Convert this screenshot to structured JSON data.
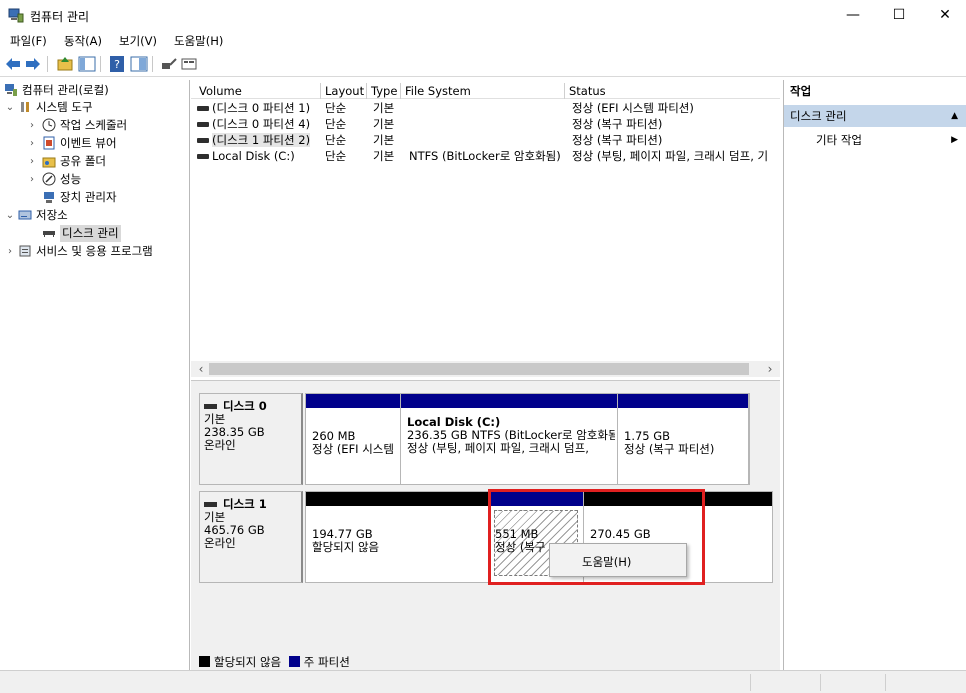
{
  "window": {
    "title": "컴퓨터 관리",
    "minimize_glyph": "—",
    "maximize_glyph": "☐",
    "close_glyph": "✕"
  },
  "menu": [
    "파일(F)",
    "동작(A)",
    "보기(V)",
    "도움말(H)"
  ],
  "toolbar": {
    "icons": [
      "back-icon",
      "forward-icon",
      "up-folder-icon",
      "show-hide-tree-icon",
      "help-icon",
      "properties-icon",
      "connect-icon",
      "view-icon"
    ]
  },
  "tree": {
    "root": "컴퓨터 관리(로컬)",
    "system_tools": "시스템 도구",
    "task_scheduler": "작업 스케줄러",
    "event_viewer": "이벤트 뷰어",
    "shared_folders": "공유 폴더",
    "performance": "성능",
    "device_manager": "장치 관리자",
    "storage": "저장소",
    "disk_management": "디스크 관리",
    "services_apps": "서비스 및 응용 프로그램"
  },
  "volume_list": {
    "columns": [
      "Volume",
      "Layout",
      "Type",
      "File System",
      "Status"
    ],
    "rows": [
      {
        "volume": "(디스크 0 파티션 1)",
        "layout": "단순",
        "type": "기본",
        "fs": "",
        "status": "정상 (EFI 시스템 파티션)"
      },
      {
        "volume": "(디스크 0 파티션 4)",
        "layout": "단순",
        "type": "기본",
        "fs": "",
        "status": "정상 (복구 파티션)"
      },
      {
        "volume": "(디스크 1 파티션 2)",
        "layout": "단순",
        "type": "기본",
        "fs": "",
        "status": "정상 (복구 파티션)"
      },
      {
        "volume": "Local Disk (C:)",
        "layout": "단순",
        "type": "기본",
        "fs": "NTFS (BitLocker로 암호화됨)",
        "status": "정상 (부팅, 페이지 파일, 크래시 덤프, 기"
      }
    ]
  },
  "disks": {
    "disk0": {
      "name": "디스크 0",
      "type": "기본",
      "size": "238.35 GB",
      "state": "온라인",
      "p1": {
        "size": "260 MB",
        "status": "정상 (EFI 시스템"
      },
      "p2": {
        "name": "Local Disk  (C:)",
        "size": "236.35 GB NTFS (BitLocker로 암호화됨",
        "status": "정상 (부팅, 페이지 파일, 크래시 덤프,"
      },
      "p3": {
        "size": "1.75 GB",
        "status": "정상 (복구 파티션)"
      }
    },
    "disk1": {
      "name": "디스크 1",
      "type": "기본",
      "size": "465.76 GB",
      "state": "온라인",
      "p1": {
        "size": "194.77 GB",
        "status": "할당되지 않음"
      },
      "p2": {
        "size": "551 MB",
        "status": "정상 (복구"
      },
      "p3": {
        "size": "270.45 GB",
        "status": ""
      }
    }
  },
  "legend": {
    "unallocated": "할당되지 않음",
    "primary": "주 파티션"
  },
  "context_menu": {
    "help": "도움말(H)"
  },
  "actions": {
    "header": "작업",
    "section": "디스크 관리",
    "more": "기타 작업"
  },
  "colors": {
    "primary_partition": "#00008b",
    "unallocated": "#000000",
    "highlight": "#e02020",
    "actions_section_bg": "#c4d6ea"
  }
}
